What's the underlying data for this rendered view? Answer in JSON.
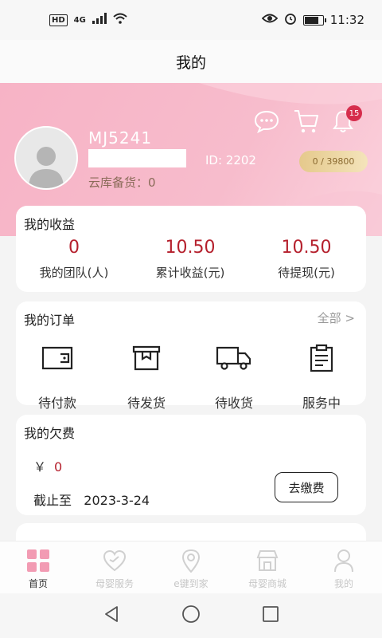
{
  "status_bar": {
    "left_badges": [
      "HD",
      "4G"
    ],
    "time": "11:32"
  },
  "header": {
    "title": "我的"
  },
  "profile": {
    "username": "MJ5241",
    "id_label": "ID: 2202",
    "stock_label": "云库备货：",
    "stock_value": "0",
    "points": "0 / 39800",
    "icons": [
      "chat-icon",
      "cart-icon",
      "bell-icon"
    ],
    "notification_count": "15"
  },
  "earnings": {
    "title": "我的收益",
    "items": [
      {
        "value": "0",
        "label": "我的团队(人)"
      },
      {
        "value": "10.50",
        "label": "累计收益(元)"
      },
      {
        "value": "10.50",
        "label": "待提现(元)"
      }
    ]
  },
  "orders": {
    "title": "我的订单",
    "all_link": "全部 >",
    "items": [
      {
        "label": "待付款",
        "icon": "wallet-icon"
      },
      {
        "label": "待发货",
        "icon": "package-icon"
      },
      {
        "label": "待收货",
        "icon": "truck-icon"
      },
      {
        "label": "服务中",
        "icon": "clipboard-icon"
      }
    ]
  },
  "arrears": {
    "title": "我的欠费",
    "currency": "￥",
    "amount": "0",
    "deadline_label": "截止至",
    "deadline_value": "2023-3-24",
    "pay_button": "去缴费"
  },
  "tab_bar": {
    "items": [
      {
        "label": "首页",
        "icon": "home-grid-icon",
        "active": true
      },
      {
        "label": "母婴服务",
        "icon": "heart-icon",
        "active": false
      },
      {
        "label": "e键到家",
        "icon": "location-icon",
        "active": false
      },
      {
        "label": "母婴商城",
        "icon": "store-icon",
        "active": false
      },
      {
        "label": "我的",
        "icon": "person-icon",
        "active": false
      }
    ]
  },
  "colors": {
    "accent_red": "#b5202d",
    "profile_pink": "#f7b3c6",
    "gold": "#e5c98c",
    "badge_red": "#d62d4c"
  }
}
